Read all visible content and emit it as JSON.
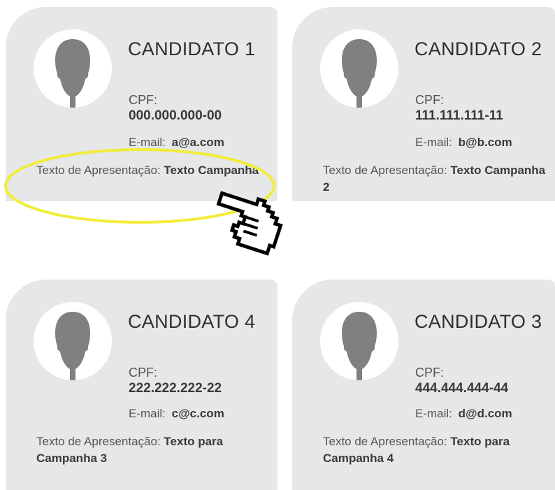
{
  "candidates": [
    {
      "name": "CANDIDATO 1",
      "cpf_label": "CPF:",
      "cpf": "000.000.000-00",
      "email_label": "E-mail:",
      "email": "a@a.com",
      "presentation_label": "Texto de Apresentação:",
      "presentation": "Texto Campanha"
    },
    {
      "name": "CANDIDATO 2",
      "cpf_label": "CPF:",
      "cpf": "111.111.111-11",
      "email_label": "E-mail:",
      "email": "b@b.com",
      "presentation_label": "Texto de Apresentação:",
      "presentation": "Texto Campanha 2"
    },
    {
      "name": "CANDIDATO 4",
      "cpf_label": "CPF:",
      "cpf": "222.222.222-22",
      "email_label": "E-mail:",
      "email": "c@c.com",
      "presentation_label": "Texto de Apresentação:",
      "presentation": "Texto para Campanha 3"
    },
    {
      "name": "CANDIDATO 3",
      "cpf_label": "CPF:",
      "cpf": "444.444.444-44",
      "email_label": "E-mail:",
      "email": "d@d.com",
      "presentation_label": "Texto de Apresentação:",
      "presentation": "Texto para Campanha 4"
    }
  ],
  "icons": {
    "avatar": "user-silhouette-icon",
    "cursor": "hand-pointer-icon"
  },
  "colors": {
    "card_background": "#e6e7e8",
    "highlight": "#f2ec3a",
    "silhouette": "#808080"
  }
}
